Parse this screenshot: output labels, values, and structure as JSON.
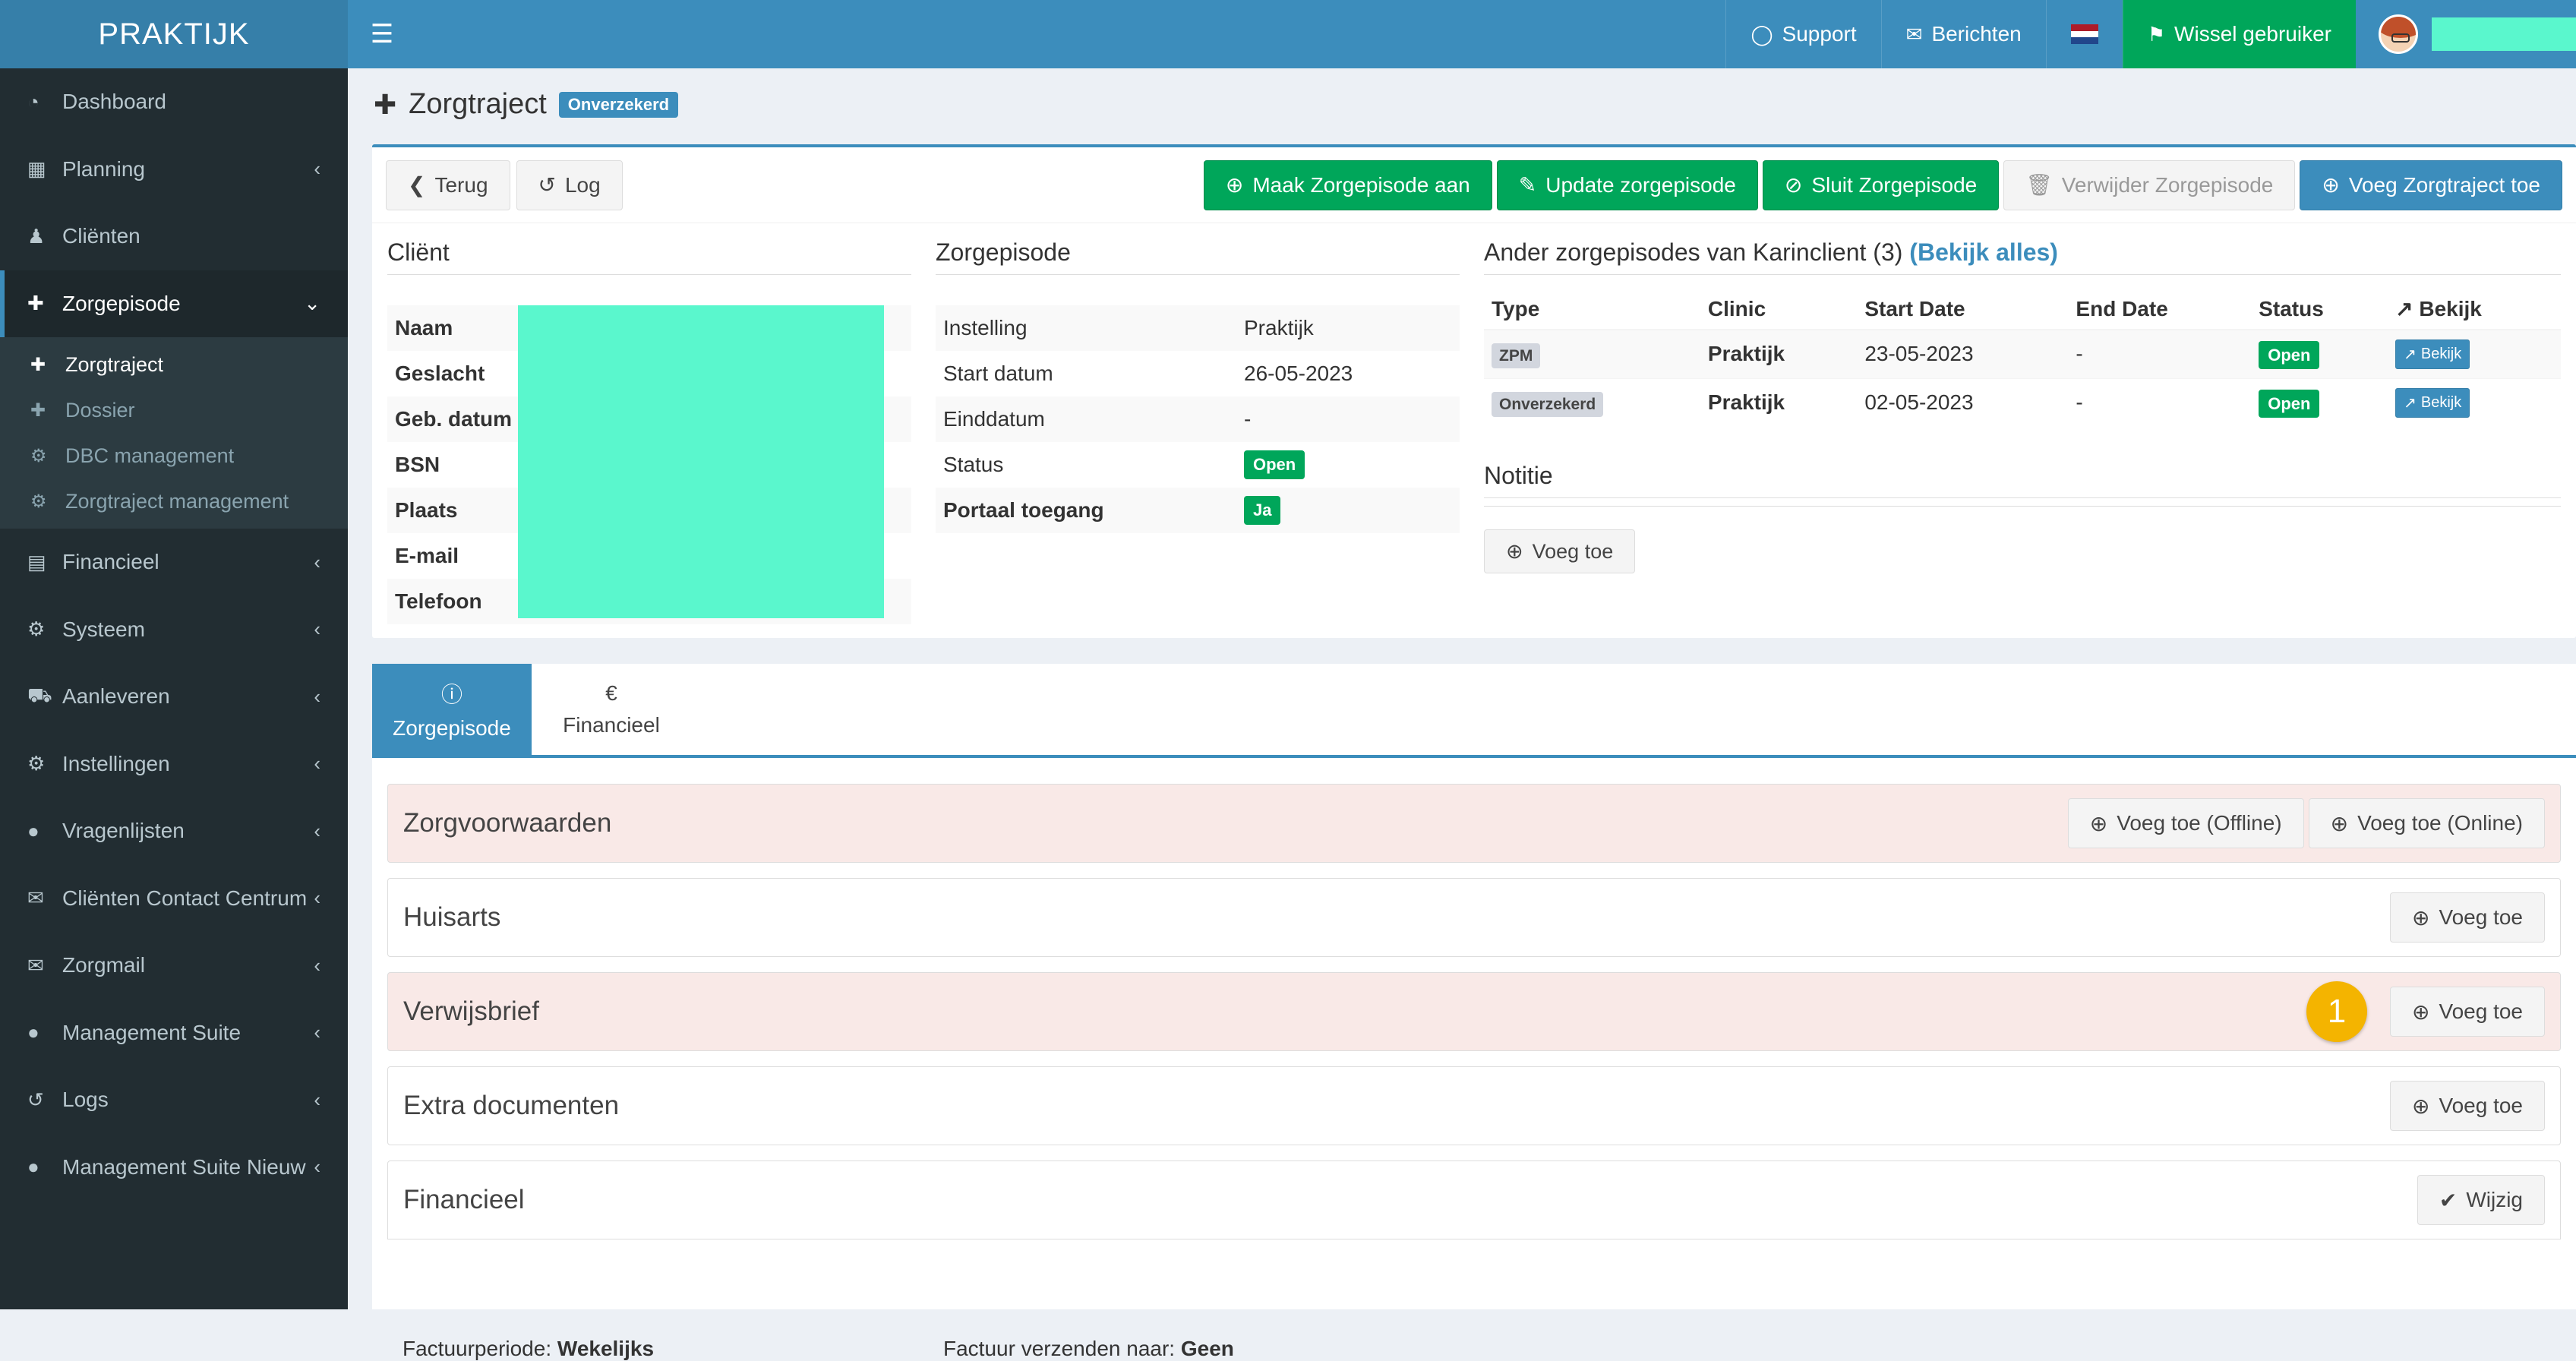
{
  "brand": "PRAKTIJK",
  "header": {
    "support": "Support",
    "messages": "Berichten",
    "switch_user": "Wissel gebruiker",
    "flag_colors": [
      "#ae1c28",
      "#ffffff",
      "#21468b"
    ],
    "redaction_color": "#5af7cd"
  },
  "sidebar": {
    "items": [
      {
        "label": "Dashboard",
        "icon": "dashboard-icon",
        "chevron": false
      },
      {
        "label": "Planning",
        "icon": "calendar-icon",
        "chevron": true
      },
      {
        "label": "Cliënten",
        "icon": "user-icon",
        "chevron": false
      },
      {
        "label": "Zorgepisode",
        "icon": "medkit-icon",
        "chevron": true,
        "active": true
      },
      {
        "label": "Financieel",
        "icon": "book-icon",
        "chevron": true
      },
      {
        "label": "Systeem",
        "icon": "gears-icon",
        "chevron": true
      },
      {
        "label": "Aanleveren",
        "icon": "truck-icon",
        "chevron": true
      },
      {
        "label": "Instellingen",
        "icon": "gear-icon",
        "chevron": true
      },
      {
        "label": "Vragenlijsten",
        "icon": "globe-icon",
        "chevron": true
      },
      {
        "label": "Cliënten Contact Centrum",
        "icon": "envelope-icon",
        "chevron": true
      },
      {
        "label": "Zorgmail",
        "icon": "envelope-icon",
        "chevron": true
      },
      {
        "label": "Management Suite",
        "icon": "globe-icon",
        "chevron": true
      },
      {
        "label": "Logs",
        "icon": "history-icon",
        "chevron": true
      },
      {
        "label": "Management Suite Nieuw",
        "icon": "globe-icon",
        "chevron": true
      }
    ],
    "submenu": [
      "Zorgtraject",
      "Dossier",
      "DBC management",
      "Zorgtraject management"
    ]
  },
  "page": {
    "title": "Zorgtraject",
    "badge": "Onverzekerd"
  },
  "toolbar": {
    "back": "Terug",
    "log": "Log",
    "create_episode": "Maak Zorgepisode aan",
    "update_episode": "Update zorgepisode",
    "close_episode": "Sluit Zorgepisode",
    "delete_episode": "Verwijder Zorgepisode",
    "add_trajectory": "Voeg Zorgtraject toe"
  },
  "client": {
    "heading": "Cliënt",
    "fields": [
      "Naam",
      "Geslacht",
      "Geb. datum",
      "BSN",
      "Plaats",
      "E-mail",
      "Telefoon"
    ]
  },
  "episode": {
    "heading": "Zorgepisode",
    "rows": [
      {
        "label": "Instelling",
        "value": "Praktijk"
      },
      {
        "label": "Start datum",
        "value": "26-05-2023"
      },
      {
        "label": "Einddatum",
        "value": "-"
      },
      {
        "label": "Status",
        "value": "Open"
      },
      {
        "label": "Portaal toegang",
        "value": "Ja"
      }
    ]
  },
  "other_episodes": {
    "heading": "Ander zorgepisodes van Karinclient (3)",
    "view_all": "(Bekijk alles)",
    "columns": [
      "Type",
      "Clinic",
      "Start Date",
      "End Date",
      "Status",
      "Bekijk"
    ],
    "rows": [
      {
        "type": "ZPM",
        "clinic": "Praktijk",
        "start": "23-05-2023",
        "end": "-",
        "status": "Open",
        "view": "Bekijk"
      },
      {
        "type": "Onverzekerd",
        "clinic": "Praktijk",
        "start": "02-05-2023",
        "end": "-",
        "status": "Open",
        "view": "Bekijk"
      }
    ]
  },
  "note": {
    "heading": "Notitie",
    "add": "Voeg toe"
  },
  "tabs": [
    {
      "label": "Zorgepisode",
      "icon": "info-icon"
    },
    {
      "label": "Financieel",
      "icon": "euro-icon"
    }
  ],
  "sections": {
    "zorgvoorwaarden": {
      "title": "Zorgvoorwaarden",
      "add_offline": "Voeg toe (Offline)",
      "add_online": "Voeg toe (Online)"
    },
    "huisarts": {
      "title": "Huisarts",
      "add": "Voeg toe"
    },
    "verwijsbrief": {
      "title": "Verwijsbrief",
      "add": "Voeg toe",
      "marker": "1"
    },
    "extra": {
      "title": "Extra documenten",
      "add": "Voeg toe"
    },
    "financieel": {
      "title": "Financieel",
      "edit": "Wijzig"
    }
  },
  "finance": {
    "period_label": "Factuurperiode:",
    "period_value": "Wekelijks",
    "send_label": "Factuur verzenden naar:",
    "send_value": "Geen"
  }
}
